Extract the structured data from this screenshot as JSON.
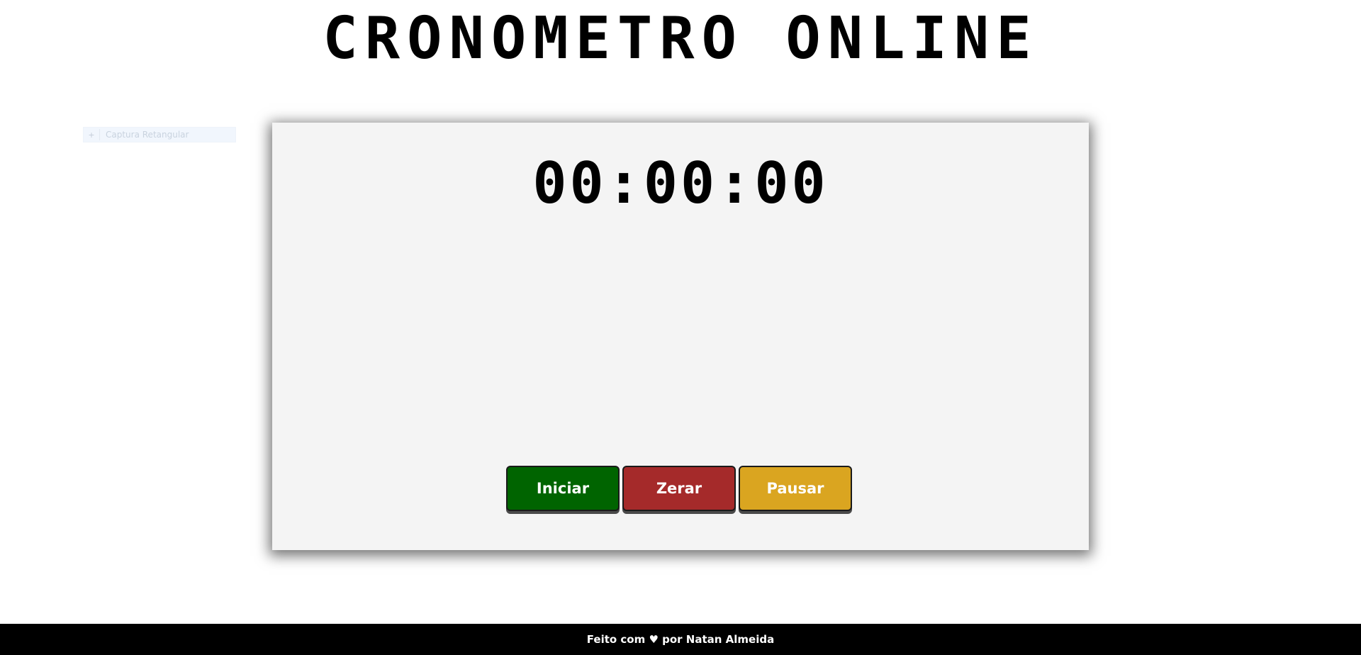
{
  "header": {
    "title": "CRONOMETRO ONLINE"
  },
  "capture_overlay": {
    "icon": "plus-icon",
    "label": "Captura Retangular"
  },
  "stopwatch": {
    "display": "00:00:00",
    "buttons": {
      "start_label": "Iniciar",
      "reset_label": "Zerar",
      "pause_label": "Pausar"
    },
    "colors": {
      "start": "#006400",
      "reset": "#a52a2a",
      "pause": "#daa520",
      "panel": "#f4f4f4"
    }
  },
  "footer": {
    "text": "Feito com ♥ por Natan Almeida",
    "background": "#000000"
  }
}
